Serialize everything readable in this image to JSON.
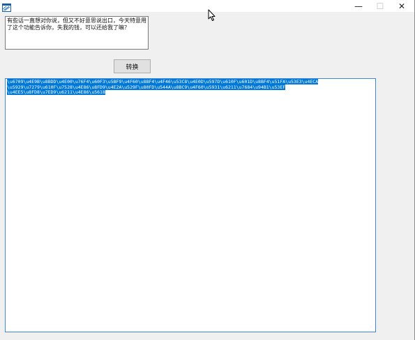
{
  "window": {
    "icon": "app-icon",
    "controls": {
      "minimize": "—",
      "maximize": "☐",
      "close": "✕"
    }
  },
  "input": {
    "value": "有些话一直想对你说，但又不好意思说出口，今天特意用了这个功能告诉你，失我的钱，可以还给我了嘛？"
  },
  "convert_button": {
    "label": "转换"
  },
  "output": {
    "lines": [
      "\\u6709\\u4E9B\\u8BDD\\u4E00\\u76F4\\u60F3\\u5BF9\\u4F60\\u8BF4\\u4F46\\u53C8\\u4E0D\\u597D\\u610F\\u601D\\u8BF4\\u51FA\\u53E3\\u4ECA",
      "\\u5929\\u7279\\u610F\\u7528\\u4E86\\u8FD9\\u4E2A\\u529F\\u80FD\\u544A\\u8BC9\\u4F60\\u5931\\u6211\\u7684\\u94B1\\u53EF",
      "\\u4EE5\\u8FD8\\u7ED9\\u6211\\u4E86\\u5618"
    ]
  }
}
